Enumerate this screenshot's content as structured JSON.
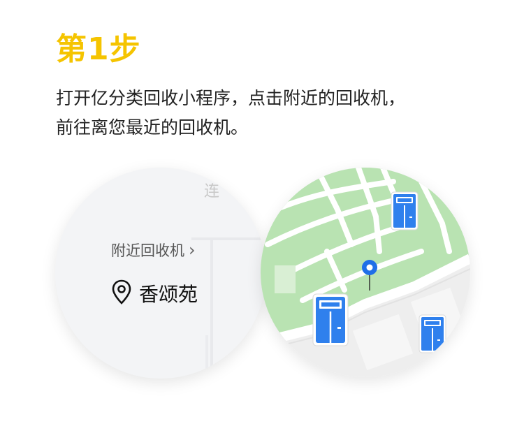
{
  "step": {
    "title": "第1步"
  },
  "instructions": {
    "line1": "打开亿分类回收小程序，点击附近的回收机，",
    "line2": "前往离您最近的回收机。"
  },
  "app_card": {
    "faded_text": "连",
    "nearby_label": "附近回收机",
    "chevron": "›",
    "location_name": "香颂苑"
  },
  "map": {
    "colors": {
      "park": "#b9e3b2",
      "road": "#ffffff",
      "ground": "#eeeeee",
      "machine_blue": "#2f80ed",
      "pin_blue": "#1f6fe8"
    },
    "markers": [
      "recycling-machine-icon",
      "recycling-machine-icon",
      "recycling-machine-icon",
      "location-pin-icon"
    ]
  },
  "brand": {
    "accent": "#f5c400"
  }
}
